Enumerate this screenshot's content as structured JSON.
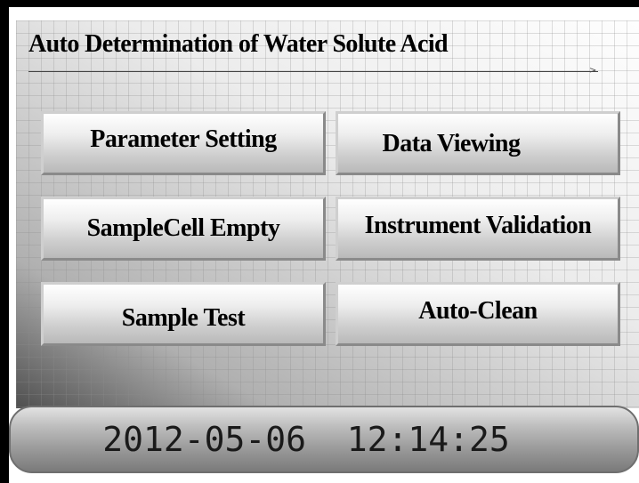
{
  "header": {
    "title": "Auto Determination of Water Solute Acid"
  },
  "menu": {
    "parameter_setting": "Parameter Setting",
    "data_viewing": "Data Viewing",
    "samplecell_empty": "SampleCell Empty",
    "instrument_validation": "Instrument Validation",
    "sample_test": "Sample Test",
    "auto_clean": "Auto-Clean"
  },
  "status": {
    "datetime": "2012-05-06  12:14:25"
  },
  "colors": {
    "frame": "#000000",
    "panel_background": "#f4f4f4",
    "button_face": "#dcdcdc",
    "status_bar": "#9a9a9a",
    "text": "#000000"
  },
  "icons": {
    "title_arrow": "arrow-right-icon"
  }
}
